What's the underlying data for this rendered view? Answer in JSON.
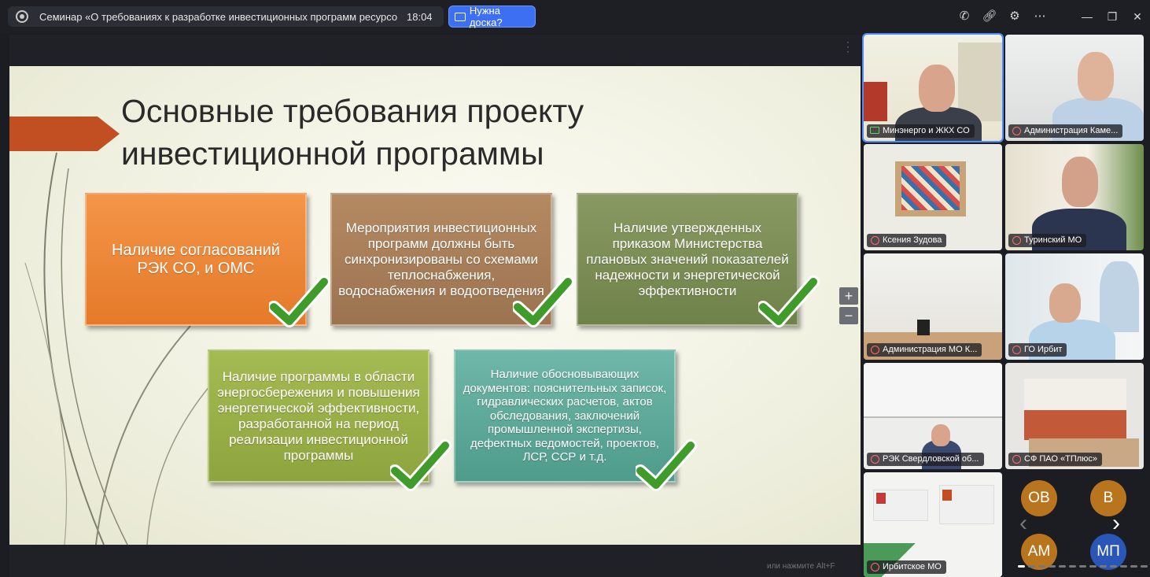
{
  "topbar": {
    "title": "Семинар «О требованиях к разработке инвестиционных программ ресурсосна...",
    "time": "18:04",
    "board_button": "Нужна доска?"
  },
  "slide": {
    "title_line1": "Основные требования проекту",
    "title_line2": "инвестиционной программы",
    "boxes": [
      {
        "text": "Наличие согласований РЭК СО, и ОМС",
        "color": "#ec8838"
      },
      {
        "text": "Мероприятия инвестиционных программ должны быть синхронизированы со схемами теплоснабжения, водоснабжения и водоотведения",
        "color": "#a88160"
      },
      {
        "text": "Наличие утвержденных приказом Министерства плановых значений показателей надежности и энергетической эффективности",
        "color": "#7d8f56"
      },
      {
        "text": "Наличие программы в области энергосбережения и повышения энергетической эффективности, разработанной на период реализации инвестиционной программы",
        "color": "#9bb048"
      },
      {
        "text": "Наличие обосновывающих документов: пояснительных записок, гидравлических расчетов, актов обследования, заключений промышленной экспертизы, дефектных ведомостей, проектов, ЛСР, ССР и т.д.",
        "color": "#5fa999"
      }
    ],
    "zoom_in": "+",
    "zoom_out": "−"
  },
  "hint": "или нажмите Alt+F",
  "participants": [
    {
      "name": "Минэнерго и ЖКХ СО"
    },
    {
      "name": "Администрация Каме..."
    },
    {
      "name": "Ксения Зудова"
    },
    {
      "name": "Туринский МО"
    },
    {
      "name": "Администрация МО К..."
    },
    {
      "name": "ГО Ирбит"
    },
    {
      "name": "РЭК Свердловской об..."
    },
    {
      "name": "СФ ПАО «ТПлюс»"
    },
    {
      "name": "Ирбитское МО"
    }
  ],
  "avatars": [
    "ОВ",
    "В",
    "АМ",
    "МП"
  ],
  "accent": "#3d6ff2"
}
